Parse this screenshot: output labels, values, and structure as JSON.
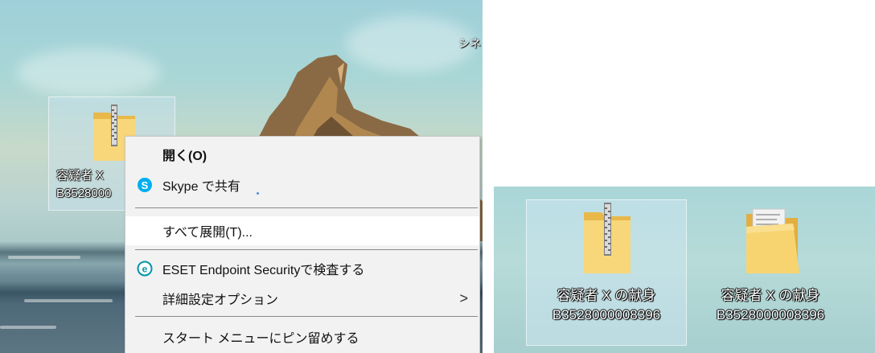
{
  "left_desktop": {
    "corner_text": "シネ",
    "file_icon": {
      "icon": "zip-folder-icon",
      "label_line1": "容疑者 X ",
      "label_line2": "B3528000"
    }
  },
  "context_menu": {
    "items": [
      {
        "label": "開く(O)",
        "icon": null,
        "bold": true
      },
      {
        "label": "Skype で共有",
        "icon": "skype-icon"
      },
      {
        "label": "すべて展開(T)...",
        "icon": null,
        "highlighted": true
      },
      {
        "label": "ESET Endpoint Securityで検査する",
        "icon": "eset-icon"
      },
      {
        "label": "詳細設定オプション",
        "icon": null,
        "submenu": true
      },
      {
        "label": "スタート メニューにピン留めする",
        "icon": null
      }
    ],
    "skype_color": "#00aff0",
    "eset_color": "#0095a8"
  },
  "right_desktop": {
    "icons": [
      {
        "icon": "zip-folder-icon",
        "line1": "容疑者 X の献身",
        "line2": "B3528000008396",
        "selected": true
      },
      {
        "icon": "folder-icon",
        "line1": "容疑者 X の献身",
        "line2": "B3528000008396",
        "selected": false
      }
    ]
  }
}
